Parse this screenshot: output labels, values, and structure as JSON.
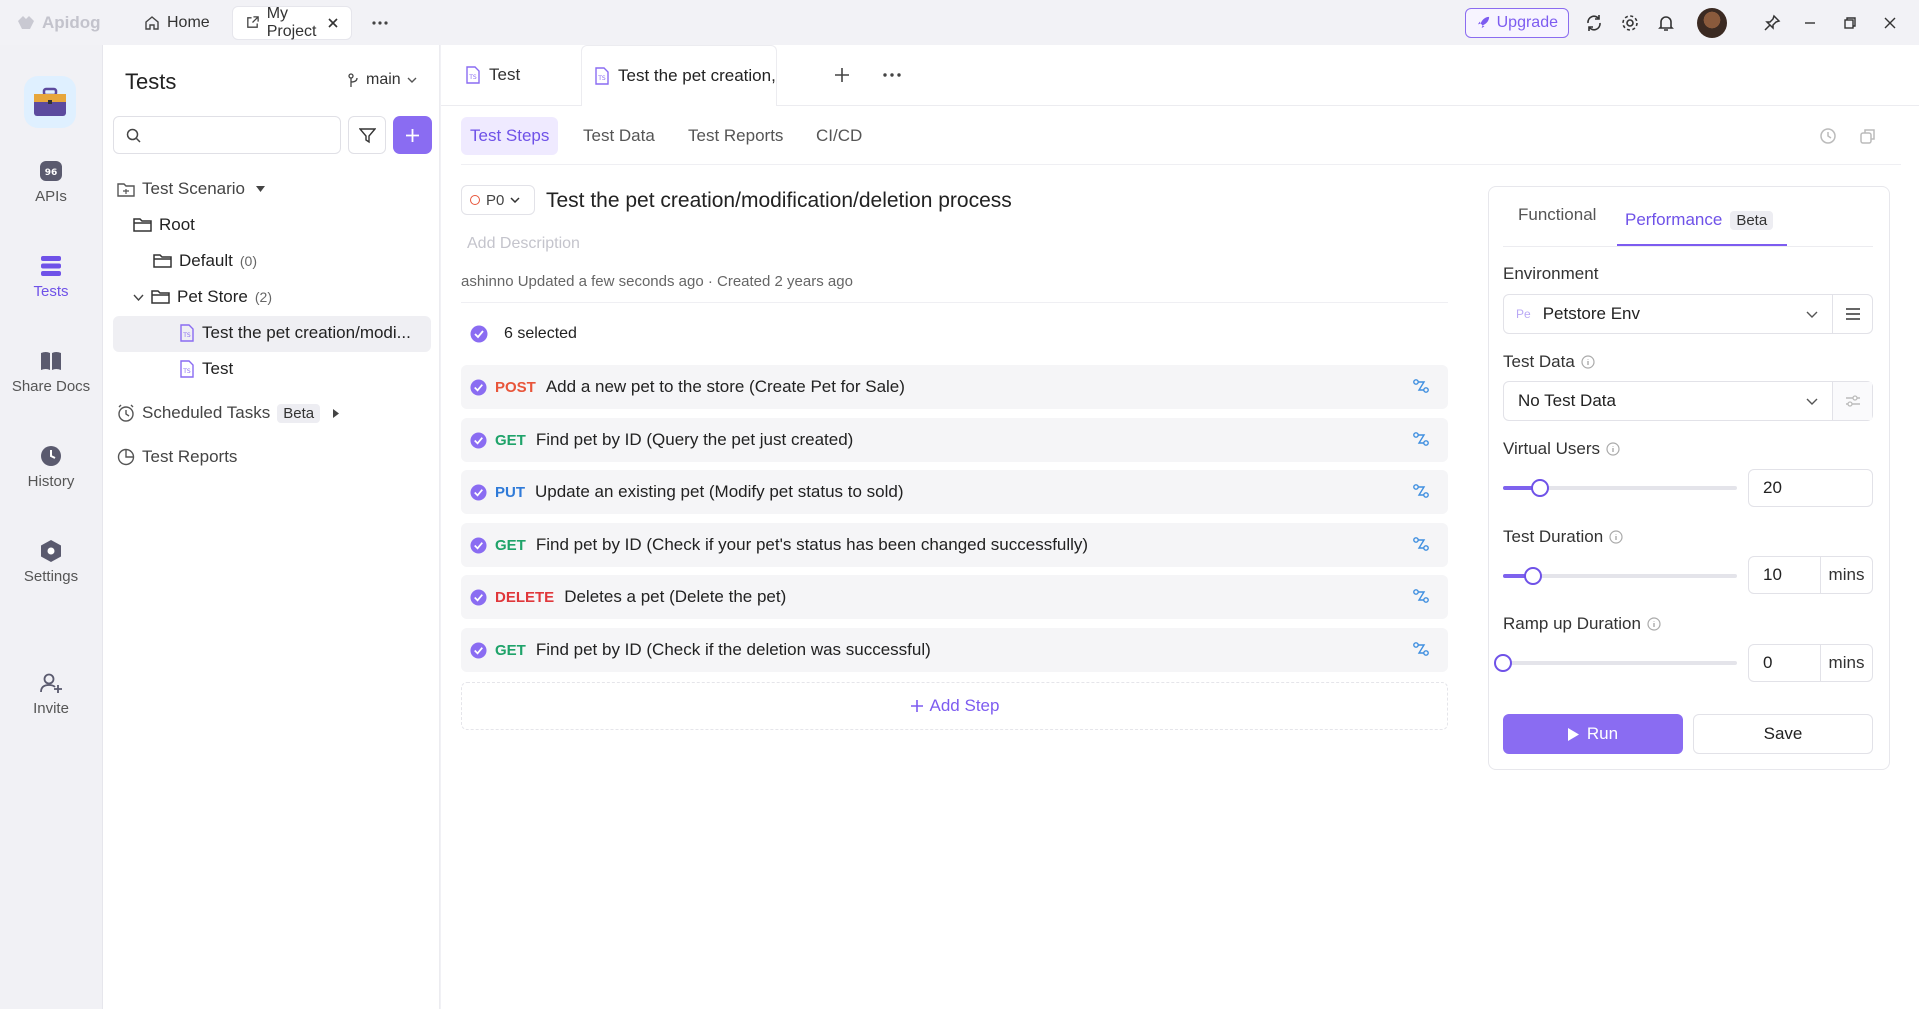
{
  "titlebar": {
    "app_name": "Apidog",
    "tabs": [
      {
        "label": "Home",
        "icon": "home-icon"
      },
      {
        "label": "My Project",
        "icon": "external-link-icon",
        "active": true
      }
    ],
    "upgrade_label": "Upgrade"
  },
  "rail": {
    "items": [
      {
        "label": "APIs",
        "icon": "api-icon"
      },
      {
        "label": "Tests",
        "icon": "tests-icon",
        "active": true
      },
      {
        "label": "Share Docs",
        "icon": "book-icon"
      },
      {
        "label": "History",
        "icon": "clock-icon"
      },
      {
        "label": "Settings",
        "icon": "hexagon-settings-icon"
      },
      {
        "label": "Invite",
        "icon": "add-user-icon"
      }
    ]
  },
  "tree": {
    "title": "Tests",
    "branch": "main",
    "search_placeholder": "",
    "items": [
      {
        "label": "Test Scenario"
      },
      {
        "label": "Root"
      },
      {
        "label": "Default",
        "count": "(0)"
      },
      {
        "label": "Pet Store",
        "count": "(2)"
      },
      {
        "label": "Test the pet creation/modi..."
      },
      {
        "label": "Test"
      },
      {
        "label": "Scheduled Tasks",
        "badge": "Beta"
      },
      {
        "label": "Test Reports"
      }
    ]
  },
  "main": {
    "file_tabs": [
      {
        "label": "Test"
      },
      {
        "label": "Test the pet creation,",
        "active": true
      }
    ],
    "sub_tabs": [
      {
        "label": "Test Steps",
        "active": true
      },
      {
        "label": "Test Data"
      },
      {
        "label": "Test Reports"
      },
      {
        "label": "CI/CD"
      }
    ],
    "priority": "P0",
    "title": "Test the pet creation/modification/deletion process",
    "description_placeholder": "Add Description",
    "meta": "ashinno Updated a few seconds ago · Created 2 years ago",
    "selected_label": "6 selected",
    "steps": [
      {
        "method": "POST",
        "text": "Add a new pet to the store (Create Pet for Sale)",
        "color": "#e8553a"
      },
      {
        "method": "GET",
        "text": "Find pet by ID (Query the pet just created)",
        "color": "#1fa36a"
      },
      {
        "method": "PUT",
        "text": "Update an existing pet (Modify pet status to sold)",
        "color": "#2f7ad8"
      },
      {
        "method": "GET",
        "text": "Find pet by ID (Check if your pet's status has been changed successfully)",
        "color": "#1fa36a"
      },
      {
        "method": "DELETE",
        "text": "Deletes a pet (Delete the pet)",
        "color": "#e0373b"
      },
      {
        "method": "GET",
        "text": "Find pet by ID (Check if the deletion was successful)",
        "color": "#1fa36a"
      }
    ],
    "add_step_label": "Add Step"
  },
  "perf_panel": {
    "tabs": [
      {
        "label": "Functional"
      },
      {
        "label": "Performance",
        "badge": "Beta",
        "active": true
      }
    ],
    "environment_label": "Environment",
    "environment_prefix": "Pe",
    "environment_value": "Petstore Env",
    "test_data_label": "Test Data",
    "test_data_value": "No Test Data",
    "virtual_users_label": "Virtual Users",
    "virtual_users_value": "20",
    "virtual_users_level": 0.16,
    "test_duration_label": "Test Duration",
    "test_duration_value": "10",
    "test_duration_level": 0.13,
    "ramp_label": "Ramp up Duration",
    "ramp_value": "0",
    "ramp_level": 0,
    "unit": "mins",
    "run_label": "Run",
    "save_label": "Save"
  },
  "colors": {
    "accent": "#7d5cf0",
    "bg": "#f1f1f5"
  }
}
